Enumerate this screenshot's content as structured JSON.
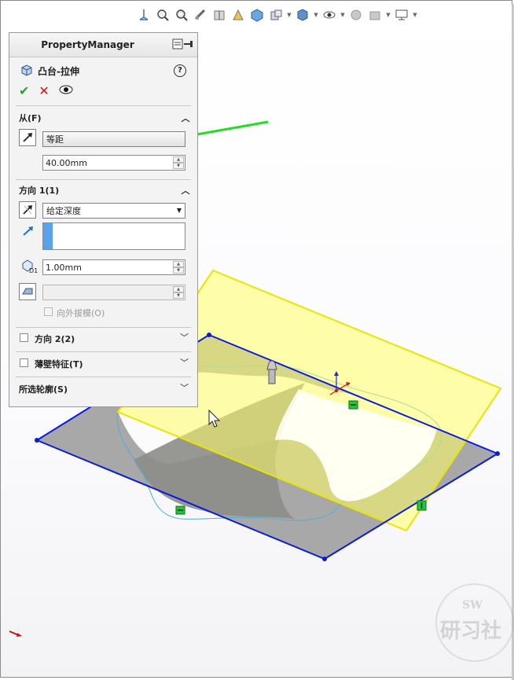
{
  "hud": {
    "icons": [
      "view-orientation-icon",
      "zoom-to-fit-icon",
      "zoom-area-icon",
      "previous-view-icon",
      "section-view-icon",
      "view-settings-icon",
      "display-style-icon",
      "hide-show-icon",
      "appearance-icon",
      "scene-icon",
      "monitor-icon"
    ]
  },
  "property_manager": {
    "header_title": "PropertyManager",
    "feature_title": "凸台-拉伸",
    "help_label": "?",
    "ok_label": "✔",
    "cancel_label": "✕",
    "from": {
      "section_label": "从(F)",
      "type_value": "等距",
      "offset_value": "40.00mm"
    },
    "direction1": {
      "section_label": "方向 1(1)",
      "end_condition": "给定深度",
      "depth_value": "1.00mm",
      "draft_value": "",
      "draft_outward_label": "向外拔模(O)",
      "draft_outward_checked": false
    },
    "direction2": {
      "section_label": "方向 2(2)",
      "checked": false
    },
    "thin_feature": {
      "section_label": "薄壁特征(T)",
      "checked": false
    },
    "selected_contours": {
      "section_label": "所选轮廓(S)"
    }
  },
  "watermark": {
    "top": "SW",
    "bottom": "研习社"
  },
  "colors": {
    "accent_arrow": "#22dd22",
    "sketch_plane": "#0a1be0",
    "offset_plane": "#ffff55",
    "relation_badge": "#22c43a",
    "selection_bar": "#5aa2ee"
  }
}
